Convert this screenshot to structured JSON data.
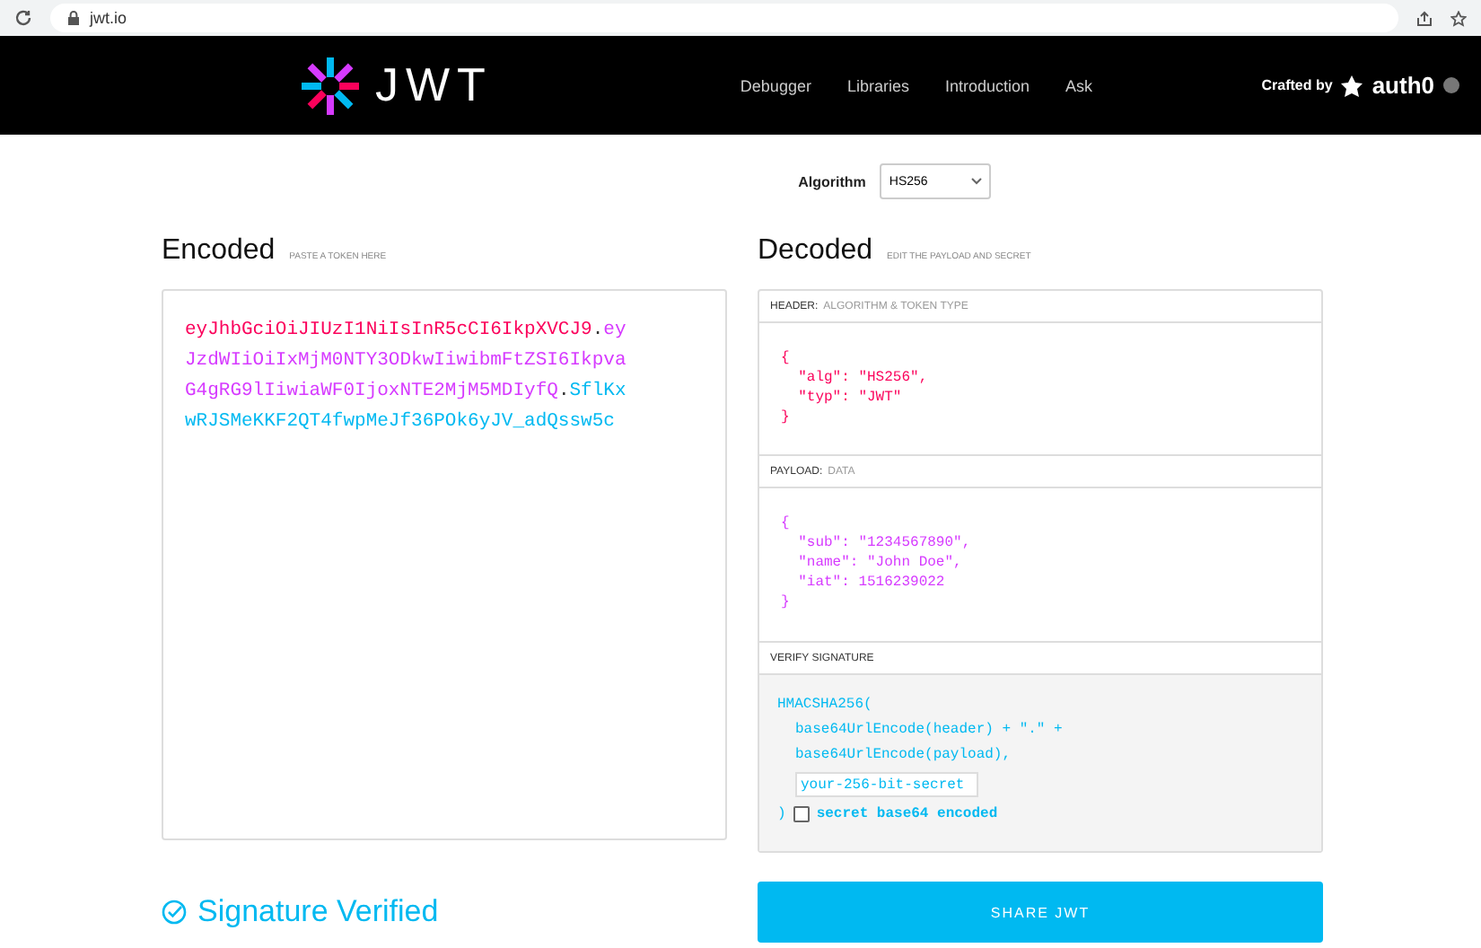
{
  "browser": {
    "url": "jwt.io"
  },
  "nav": {
    "logo_text": "JWT",
    "links": [
      {
        "label": "Debugger"
      },
      {
        "label": "Libraries"
      },
      {
        "label": "Introduction"
      },
      {
        "label": "Ask"
      }
    ],
    "crafted_by": "Crafted by",
    "brand": "auth0"
  },
  "algorithm": {
    "label": "Algorithm",
    "value": "HS256"
  },
  "encoded": {
    "title": "Encoded",
    "hint": "PASTE A TOKEN HERE",
    "lines": [
      [
        {
          "kind": "header",
          "text": "eyJhbGciOiJIUzI1NiIsInR5cCI6IkpXVCJ9"
        },
        {
          "kind": "dot",
          "text": "."
        },
        {
          "kind": "payload",
          "text": "ey"
        }
      ],
      [
        {
          "kind": "payload",
          "text": "JzdWIiOiIxMjM0NTY3ODkwIiwibmFtZSI6Ikpva"
        }
      ],
      [
        {
          "kind": "payload",
          "text": "G4gRG9lIiwiaWF0IjoxNTE2MjM5MDIyfQ"
        },
        {
          "kind": "dot",
          "text": "."
        },
        {
          "kind": "signature",
          "text": "SflKx"
        }
      ],
      [
        {
          "kind": "signature",
          "text": "wRJSMeKKF2QT4fwpMeJf36POk6yJV_adQssw5c"
        }
      ]
    ]
  },
  "decoded": {
    "title": "Decoded",
    "hint": "EDIT THE PAYLOAD AND SECRET",
    "sections": [
      {
        "kind": "header",
        "label": "HEADER:",
        "sublabel": "ALGORITHM & TOKEN TYPE",
        "lines": [
          "{",
          "  \"alg\": \"HS256\",",
          "  \"typ\": \"JWT\"",
          "}"
        ]
      },
      {
        "kind": "payload",
        "label": "PAYLOAD:",
        "sublabel": "DATA",
        "lines": [
          "{",
          "  \"sub\": \"1234567890\",",
          "  \"name\": \"John Doe\",",
          "  \"iat\": 1516239022",
          "}"
        ]
      }
    ],
    "verify": {
      "label": "VERIFY SIGNATURE",
      "open": "HMACSHA256(",
      "args": [
        "base64UrlEncode(header) + \".\" +",
        "base64UrlEncode(payload),"
      ],
      "secret_value": "your-256-bit-secret",
      "close": ")",
      "checkbox_label": "secret base64 encoded",
      "checked": false
    }
  },
  "status": {
    "text": "Signature Verified",
    "verified": true
  },
  "share_button": "SHARE JWT"
}
